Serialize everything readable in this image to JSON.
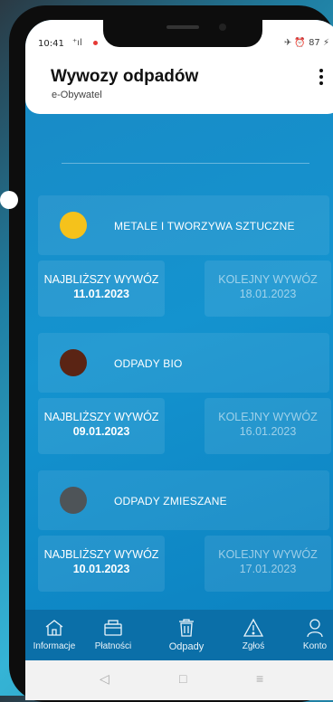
{
  "status_bar": {
    "time": "10:41",
    "signal": "⁺ıl",
    "icons_right": "✈ ⏰ 87 ⚡"
  },
  "app": {
    "title": "Wywozy odpadów",
    "subtitle": "e-Obywatel"
  },
  "waste_types": [
    {
      "name": "METALE I TWORZYWA SZTUCZNE",
      "color": "#F5C21B",
      "next_label": "NAJBLIŻSZY WYWÓZ",
      "next_date": "11.01.2023",
      "later_label": "KOLEJNY WYWÓZ",
      "later_date": "18.01.2023"
    },
    {
      "name": "ODPADY BIO",
      "color": "#5A2414",
      "next_label": "NAJBLIŻSZY WYWÓZ",
      "next_date": "09.01.2023",
      "later_label": "KOLEJNY WYWÓZ",
      "later_date": "16.01.2023"
    },
    {
      "name": "ODPADY ZMIESZANE",
      "color": "#4E5458",
      "next_label": "NAJBLIŻSZY WYWÓZ",
      "next_date": "10.01.2023",
      "later_label": "KOLEJNY WYWÓZ",
      "later_date": "17.01.2023"
    }
  ],
  "bottom_nav": [
    {
      "label": "Informacje",
      "icon": "home-icon"
    },
    {
      "label": "Płatności",
      "icon": "payments-icon"
    },
    {
      "label": "Odpady",
      "icon": "trash-icon",
      "active": true
    },
    {
      "label": "Zgłoś",
      "icon": "report-icon"
    },
    {
      "label": "Konto",
      "icon": "account-icon"
    }
  ],
  "colors": {
    "accent": "#1493CF",
    "nav_background": "#0B6FA8"
  }
}
